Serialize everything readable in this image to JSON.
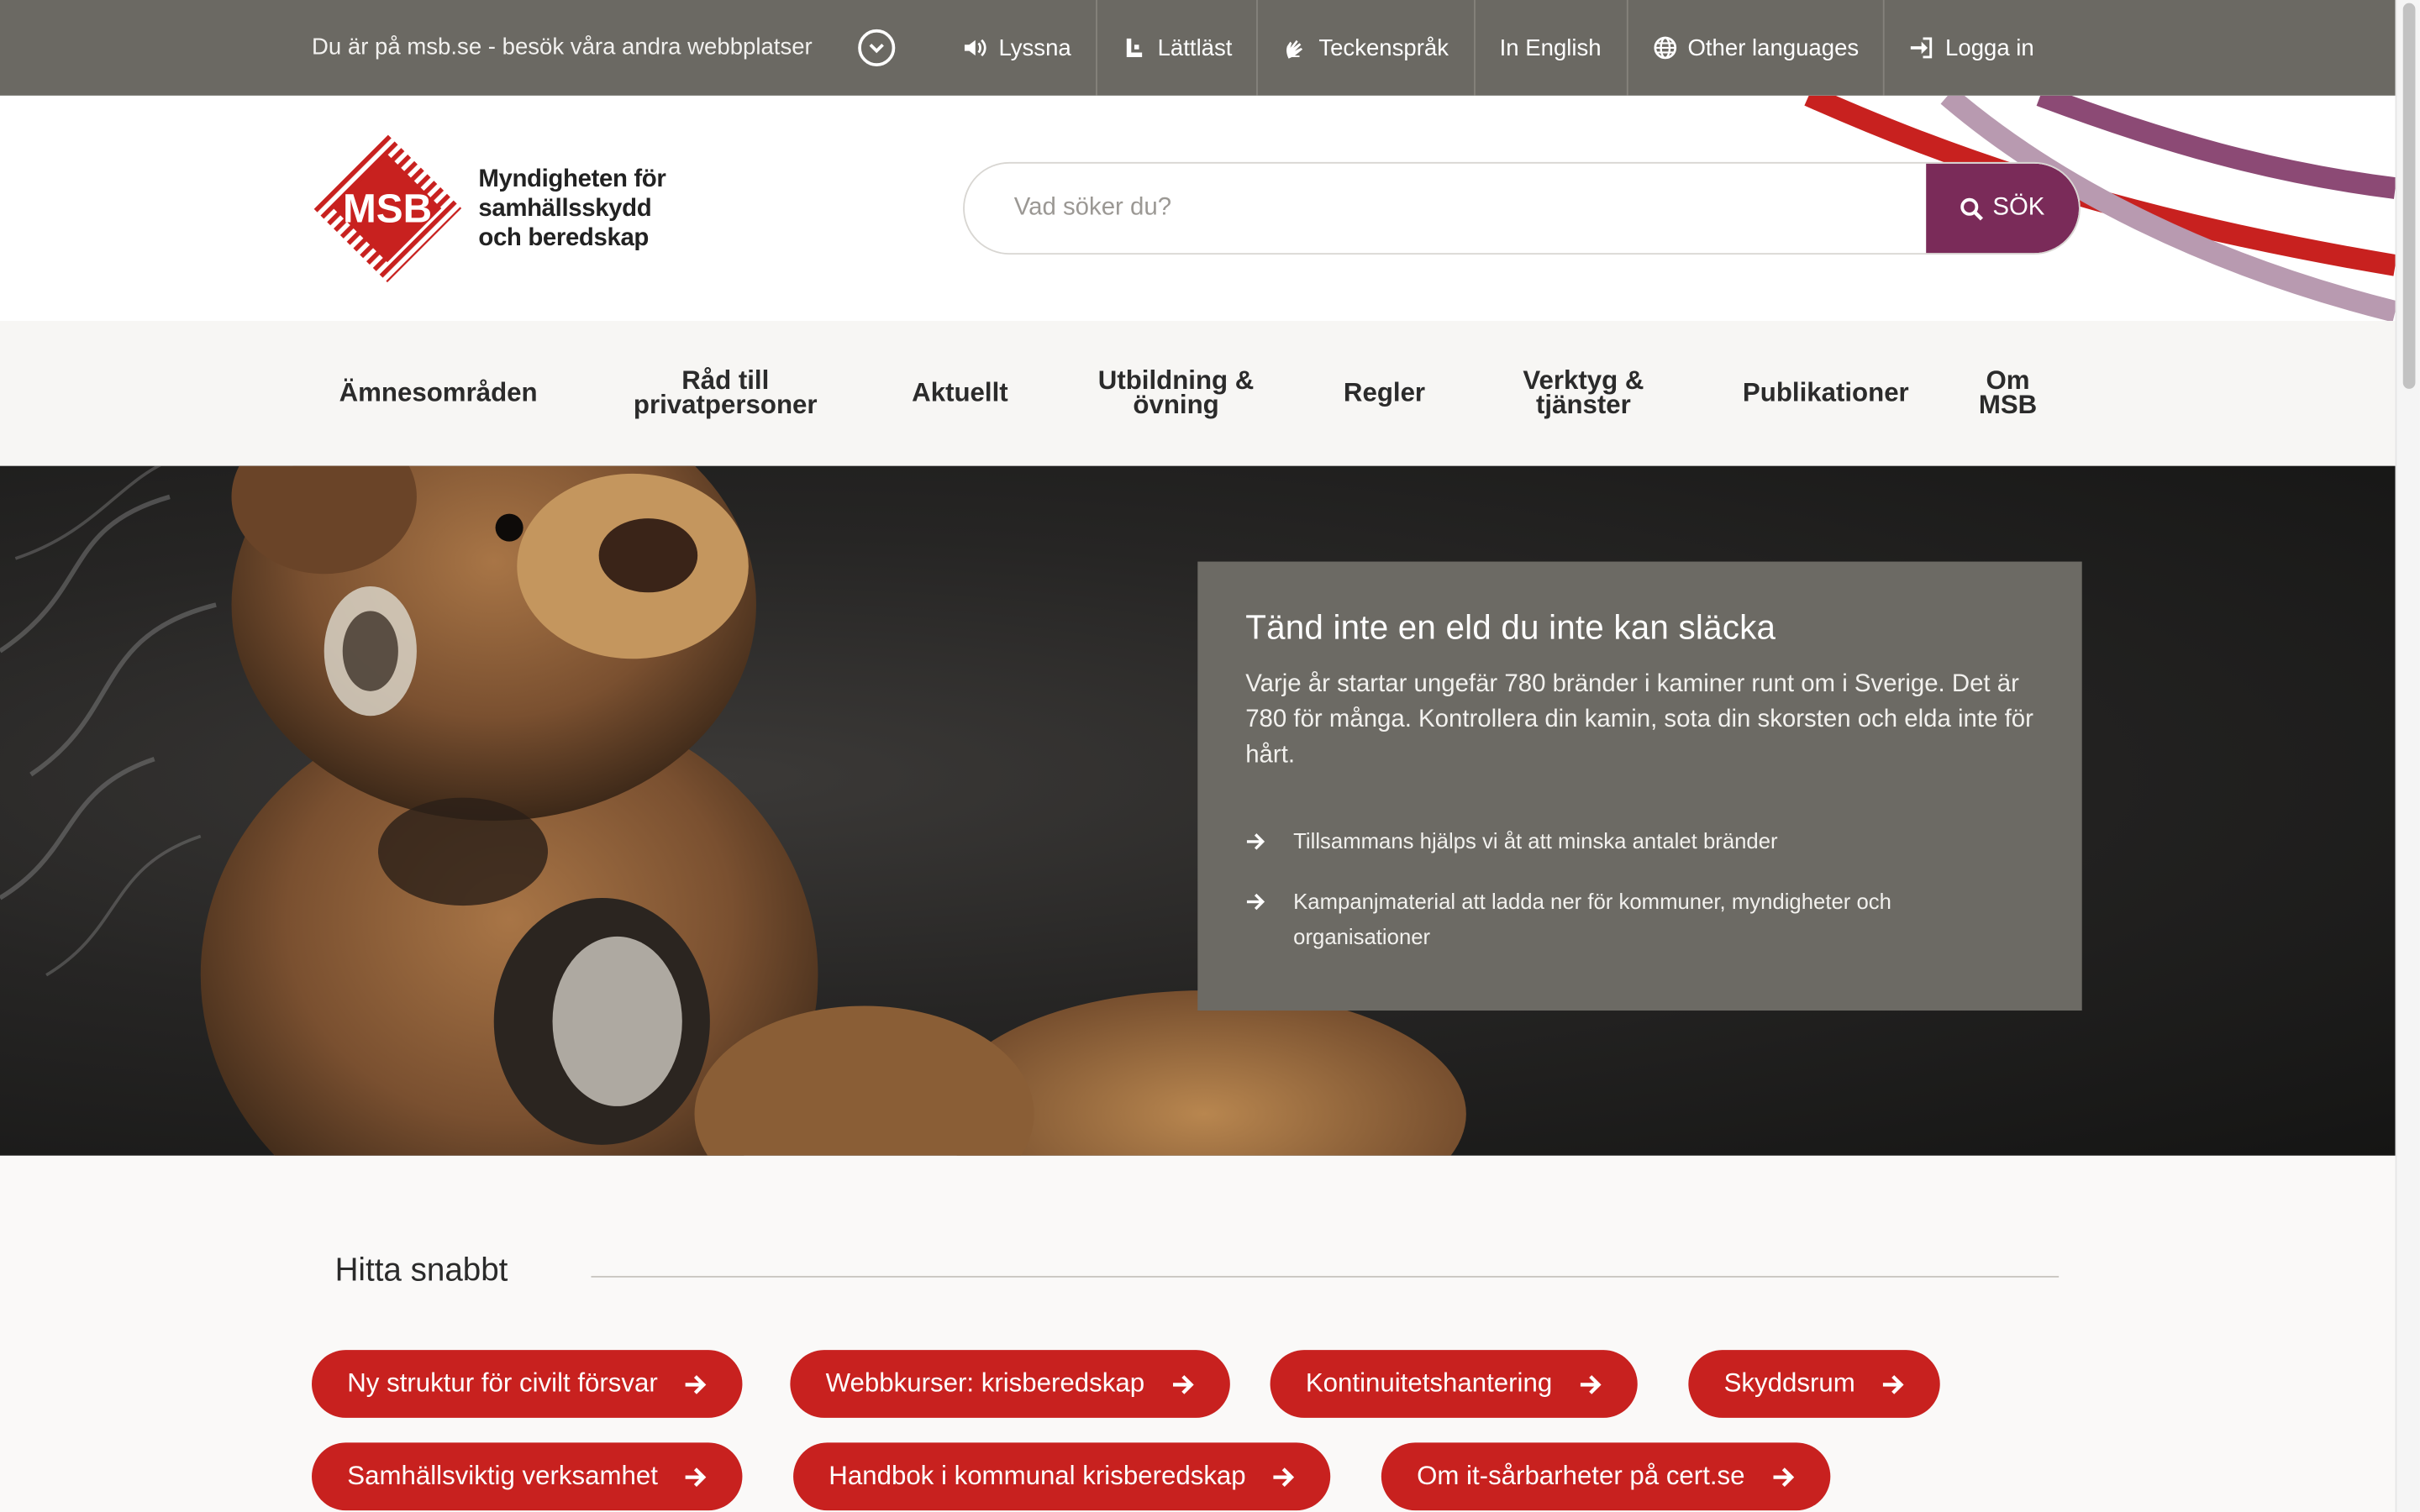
{
  "topbar": {
    "visit_text": "Du är på msb.se - besök våra andra webbplatser",
    "tools": [
      {
        "label": "Lyssna",
        "icon": "speaker-icon"
      },
      {
        "label": "Lättläst",
        "icon": "easy-read-icon"
      },
      {
        "label": "Teckenspråk",
        "icon": "sign-language-icon"
      },
      {
        "label": "In English",
        "icon": ""
      },
      {
        "label": "Other languages",
        "icon": "globe-icon"
      },
      {
        "label": "Logga in",
        "icon": "login-icon"
      }
    ]
  },
  "header": {
    "logo_letters": "MSB",
    "logo_text_line1": "Myndigheten för",
    "logo_text_line2": "samhällsskydd",
    "logo_text_line3": "och beredskap",
    "search_placeholder": "Vad söker du?",
    "search_button": "SÖK"
  },
  "nav": {
    "items": [
      {
        "label": "Ämnesområden"
      },
      {
        "label": "Råd till privatpersoner"
      },
      {
        "label": "Aktuellt"
      },
      {
        "label": "Utbildning & övning"
      },
      {
        "label": "Regler"
      },
      {
        "label": "Verktyg & tjänster"
      },
      {
        "label": "Publikationer"
      },
      {
        "label": "Om MSB"
      }
    ]
  },
  "hero": {
    "title": "Tänd inte en eld du inte kan släcka",
    "body": "Varje år startar ungefär 780 bränder i kaminer runt om i Sverige. Det är 780 för många. Kontrollera din kamin, sota din skorsten och elda inte för hårt.",
    "links": [
      "Tillsammans hjälps vi åt att minska antalet bränder",
      "Kampanjmaterial att ladda ner för kommuner, myndigheter och organisationer"
    ]
  },
  "quick": {
    "title": "Hitta snabbt",
    "links": [
      "Ny struktur för civilt försvar",
      "Webbkurser: krisberedskap",
      "Kontinuitetshantering",
      "Skyddsrum",
      "Samhällsviktig verksamhet",
      "Handbok i kommunal krisberedskap",
      "Om it-sårbarheter på cert.se"
    ]
  },
  "colors": {
    "topbar": "#6b6963",
    "brand_red": "#c8211f",
    "search_button": "#7a2b59",
    "hero_box": "#6c6a64"
  }
}
